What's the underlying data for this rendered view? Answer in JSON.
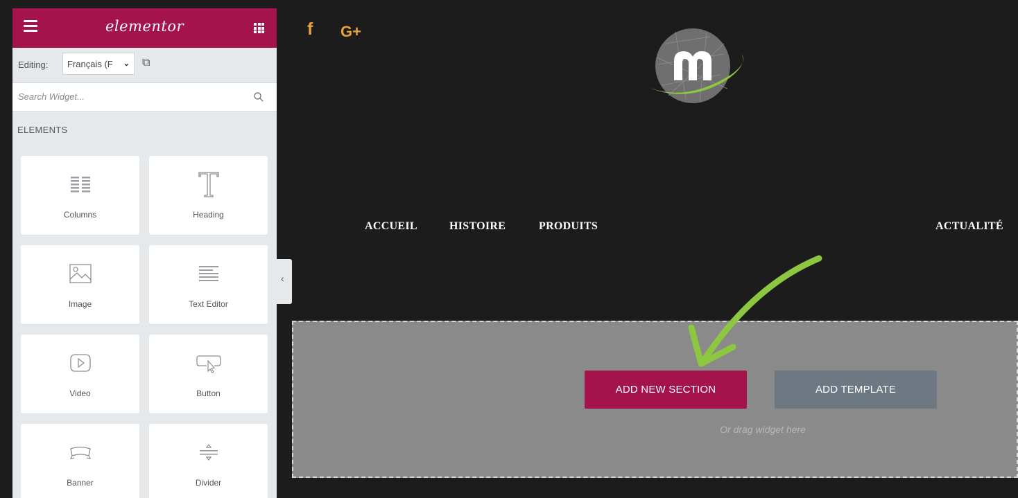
{
  "sidebar": {
    "logo": "elementor",
    "editing_label": "Editing:",
    "language_value": "Français (F",
    "search_placeholder": "Search Widget...",
    "elements_title": "ELEMENTS",
    "widgets": [
      {
        "label": "Columns",
        "icon": "columns-icon"
      },
      {
        "label": "Heading",
        "icon": "heading-icon"
      },
      {
        "label": "Image",
        "icon": "image-icon"
      },
      {
        "label": "Text Editor",
        "icon": "text-editor-icon"
      },
      {
        "label": "Video",
        "icon": "video-icon"
      },
      {
        "label": "Button",
        "icon": "button-icon"
      },
      {
        "label": "Banner",
        "icon": "banner-icon"
      },
      {
        "label": "Divider",
        "icon": "divider-icon"
      }
    ]
  },
  "preview": {
    "social": {
      "facebook": "f",
      "google_plus": "G+"
    },
    "nav": [
      "ACCUEIL",
      "HISTOIRE",
      "PRODUITS",
      "ACTUALITÉ"
    ],
    "add_section_label": "ADD NEW SECTION",
    "add_template_label": "ADD TEMPLATE",
    "drag_hint": "Or drag widget here"
  },
  "colors": {
    "brand": "#a4134c",
    "template_button": "#6d7882",
    "social": "#e8a23a",
    "arrow": "#8dc63f",
    "background": "#1c1c1c"
  }
}
